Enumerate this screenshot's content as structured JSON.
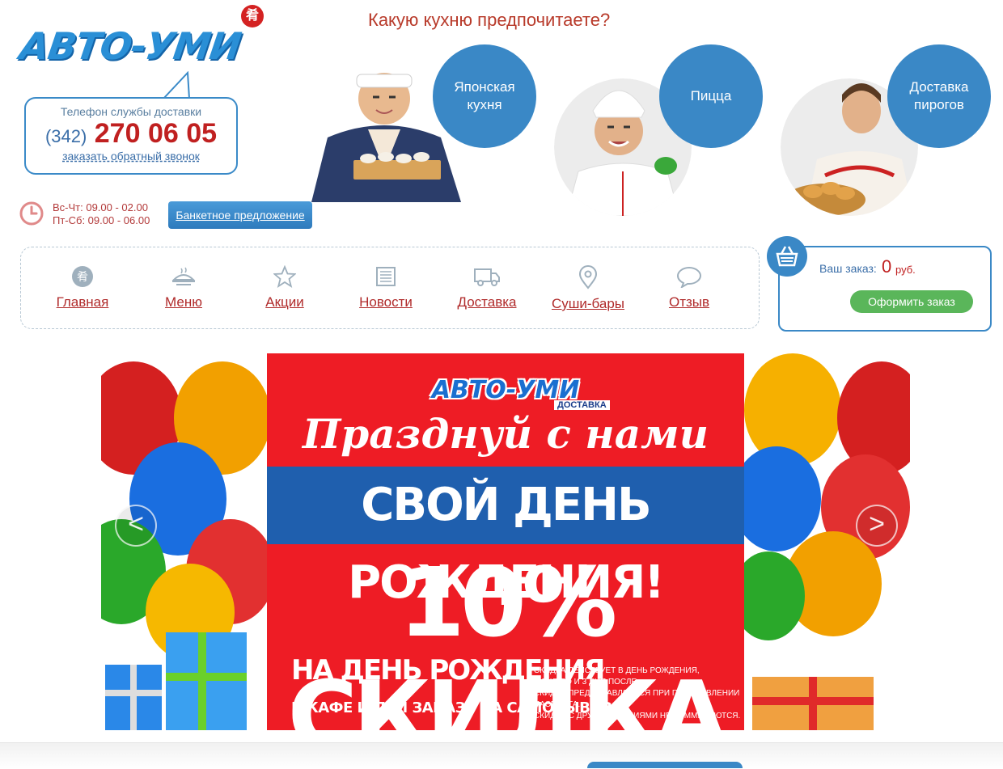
{
  "header": {
    "logo_text": "АВТО-УМИ",
    "logo_badge": "肴",
    "phone_label": "Телефон службы доставки",
    "phone_code": "(342)",
    "phone_number": "270 06 05",
    "callback_label": "заказать обратный звонок",
    "hours_line1": "Вс-Чт: 09.00 - 02.00",
    "hours_line2": "Пт-Сб: 09.00 - 06.00",
    "banquet_label": "Банкетное предложение"
  },
  "cuisine": {
    "title": "Какую кухню предпочитаете?",
    "items": [
      {
        "label": "Японская кухня"
      },
      {
        "label": "Пицца"
      },
      {
        "label": "Доставка пирогов"
      }
    ]
  },
  "nav": {
    "items": [
      {
        "label": "Главная",
        "icon": "logo-icon"
      },
      {
        "label": "Меню",
        "icon": "dish-icon"
      },
      {
        "label": "Акции",
        "icon": "star-icon"
      },
      {
        "label": "Новости",
        "icon": "newspaper-icon"
      },
      {
        "label": "Доставка",
        "icon": "truck-icon"
      },
      {
        "label": "Суши-бары",
        "icon": "location-pin-icon"
      },
      {
        "label": "Отзыв",
        "icon": "speech-bubble-icon"
      }
    ]
  },
  "cart": {
    "order_label": "Ваш заказ:",
    "amount": "0",
    "currency": "руб.",
    "checkout_label": "Оформить заказ"
  },
  "banner": {
    "logo_text": "АВТО-УМИ",
    "logo_sub": "ДОСТАВКА",
    "script_line": "Празднуй с нами",
    "headline": "СВОЙ ДЕНЬ РОЖДЕНИЯ!",
    "discount": "10% СКИДКА",
    "bday_line": "НА ДЕНЬ РОЖДЕНИЯ",
    "cafe_line": "В КАФЕ И ПРИ ЗАКАЗЕ НА САМОВЫВОЗ",
    "note_line1": "*СКИДКА ДЕЙСТВУЕТ В ДЕНЬ РОЖДЕНИЯ,",
    "note_line2": "3 ДНЯ ДО И 3 ДНЯ ПОСЛЕ.",
    "note_line3": "СКИДКА ПРЕДОСТАВЛЯЕТСЯ ПРИ ПРЕДЪЯВЛЕНИИ ПАСПОРТА.",
    "note_line4": "СКИДКИ С ДРУГИМИ АКЦИЯМИ НЕ СУММИРУЮТСЯ.",
    "prev_label": "<",
    "next_label": ">"
  },
  "colors": {
    "brand_blue": "#3a88c6",
    "brand_red": "#c02020",
    "banner_red": "#ee1c25",
    "banner_blue": "#1f5fae",
    "checkout_green": "#5ab65a"
  }
}
